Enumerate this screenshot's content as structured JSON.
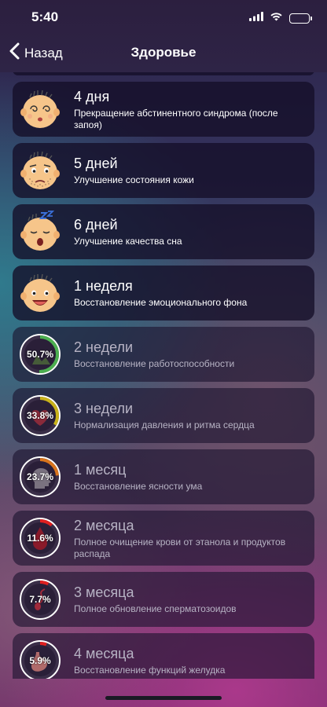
{
  "status": {
    "time": "5:40"
  },
  "nav": {
    "back": "Назад",
    "title": "Здоровье"
  },
  "items": [
    {
      "title": "4 дня",
      "subtitle": "Прекращение абстинентного синдрома (после запоя)"
    },
    {
      "title": "5 дней",
      "subtitle": "Улучшение состояния кожи"
    },
    {
      "title": "6 дней",
      "subtitle": "Улучшение качества сна"
    },
    {
      "title": "1 неделя",
      "subtitle": "Восстановление эмоционального фона"
    },
    {
      "title": "2 недели",
      "subtitle": "Восстановление работоспособности",
      "percent": "50.7%",
      "progress": 0.507
    },
    {
      "title": "3 недели",
      "subtitle": "Нормализация давления и ритма сердца",
      "percent": "33.8%",
      "progress": 0.338
    },
    {
      "title": "1 месяц",
      "subtitle": "Восстановление ясности ума",
      "percent": "23.7%",
      "progress": 0.237
    },
    {
      "title": "2 месяца",
      "subtitle": "Полное очищение крови от этанола и продуктов распада",
      "percent": "11.6%",
      "progress": 0.116
    },
    {
      "title": "3 месяца",
      "subtitle": "Полное обновление сперматозоидов",
      "percent": "7.7%",
      "progress": 0.077
    },
    {
      "title": "4 месяца",
      "subtitle": "Восстановление функций желудка",
      "percent": "5.9%",
      "progress": 0.059
    }
  ],
  "colors": {
    "ringGreen": "#4caf50",
    "ringYellow": "#c9b21a",
    "ringOrange": "#d8741c",
    "ringRed": "#e02020",
    "face": "#f6c58a"
  }
}
